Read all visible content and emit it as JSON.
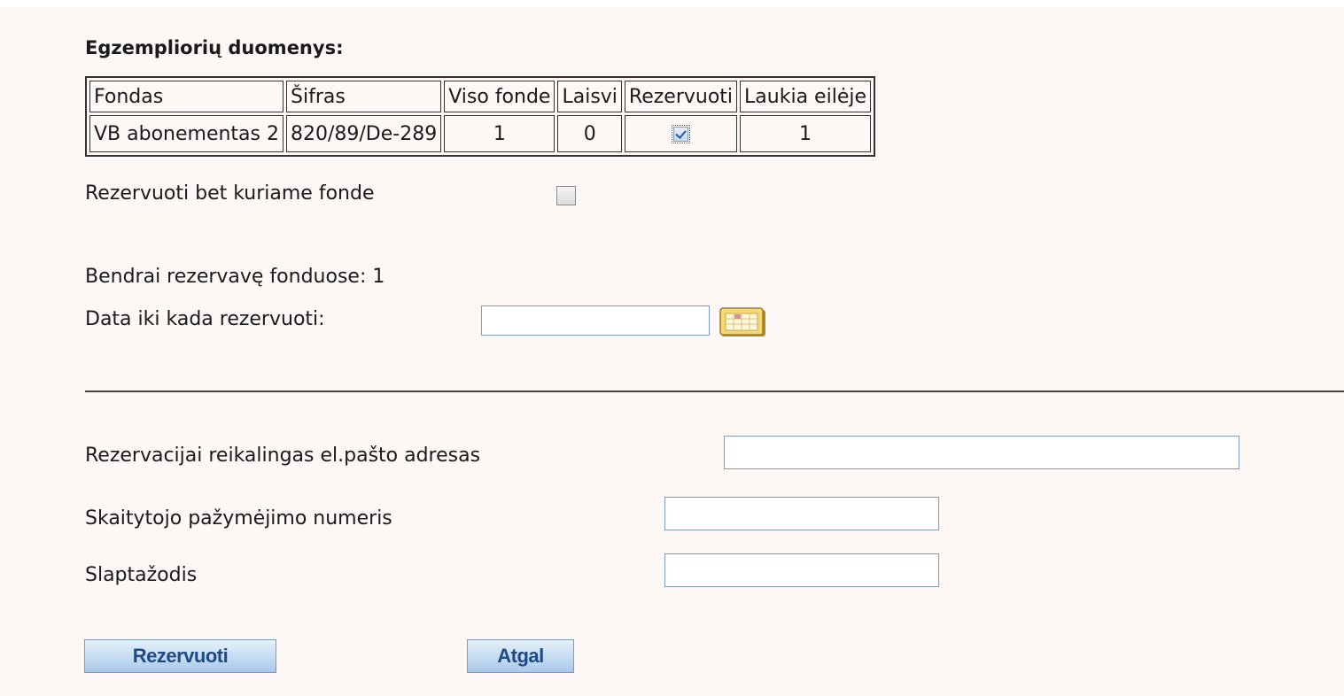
{
  "section_title": "Egzempliorių duomenys:",
  "holdings": {
    "headers": [
      "Fondas",
      "Šifras",
      "Viso fonde",
      "Laisvi",
      "Rezervuoti",
      "Laukia eilėje"
    ],
    "row": {
      "fondas": "VB abonementas 2",
      "sifras": "820/89/De-289",
      "viso_fonde": "1",
      "laisvi": "0",
      "rezervuoti_checked": true,
      "laukia_eileje": "1"
    }
  },
  "reserve_any_fund": {
    "label": "Rezervuoti bet kuriame fonde",
    "checked": false
  },
  "total_reserved": "Bendrai rezervavę fonduose: 1",
  "date_until": {
    "label": "Data iki kada rezervuoti:",
    "value": "",
    "icon": "calendar-icon"
  },
  "email": {
    "label": "Rezervacijai reikalingas el.pašto adresas",
    "value": ""
  },
  "reader_card": {
    "label": "Skaitytojo pažymėjimo numeris",
    "value": ""
  },
  "password": {
    "label": "Slaptažodis",
    "value": ""
  },
  "buttons": {
    "reserve": "Rezervuoti",
    "back": "Atgal"
  },
  "colors": {
    "panel_background": "#fdf8f5",
    "button_text": "#1f4a86",
    "input_border": "#7f9db9"
  }
}
